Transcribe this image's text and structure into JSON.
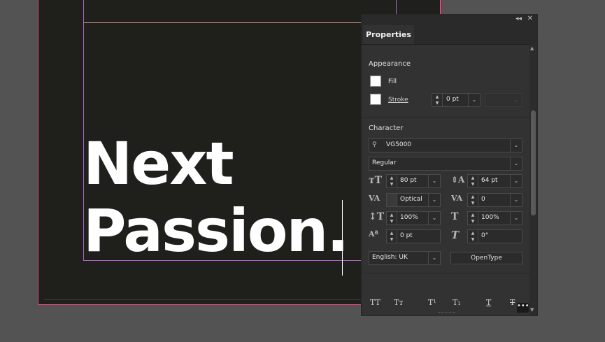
{
  "canvas": {
    "headline_line1": "Next",
    "headline_line2": "Passion."
  },
  "panel": {
    "tab_label": "Properties",
    "appearance": {
      "title": "Appearance",
      "fill_label": "Fill",
      "stroke_label": "Stroke",
      "stroke_weight": "0 pt"
    },
    "character": {
      "title": "Character",
      "font_family": "VG5000",
      "font_style": "Regular",
      "font_size": "80 pt",
      "leading": "64 pt",
      "kerning": "Optical",
      "tracking": "0",
      "vertical_scale": "100%",
      "horizontal_scale": "100%",
      "baseline_shift": "0 pt",
      "skew": "0°",
      "language": "English: UK",
      "opentype_label": "OpenType"
    },
    "colors": {
      "fill": "#ffffff",
      "stroke": "#ffffff",
      "page_bg": "#1f201c"
    }
  }
}
